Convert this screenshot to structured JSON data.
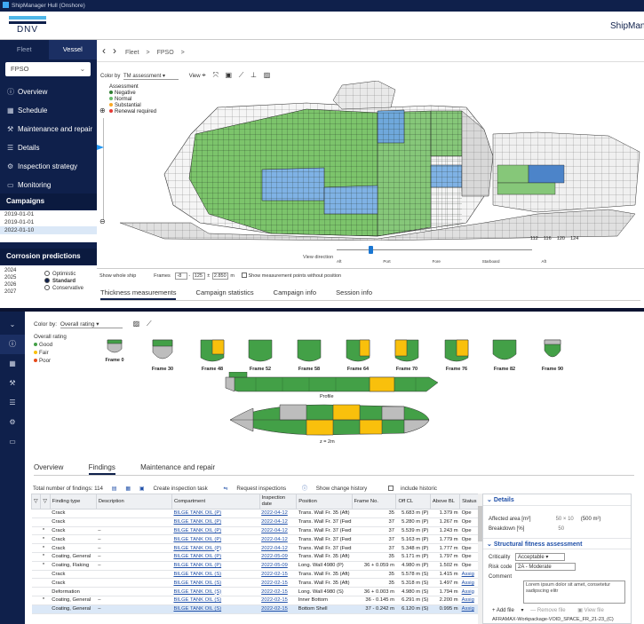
{
  "titlebar": {
    "title": "ShipManager Hull (Onshore)"
  },
  "header": {
    "logo": "DNV",
    "app_title": "ShipMan"
  },
  "sidebar": {
    "tabs": [
      "Fleet",
      "Vessel"
    ],
    "vessel_select": "FPSO",
    "menu": [
      {
        "label": "Overview",
        "icon": "info-icon"
      },
      {
        "label": "Schedule",
        "icon": "calendar-icon"
      },
      {
        "label": "Maintenance and repair",
        "icon": "wrench-icon"
      },
      {
        "label": "Details",
        "icon": "list-icon"
      },
      {
        "label": "Inspection strategy",
        "icon": "gear-icon"
      },
      {
        "label": "Monitoring",
        "icon": "monitor-icon"
      }
    ],
    "campaigns_title": "Campaigns",
    "campaigns": [
      "2019-01-01",
      "2019-01-01",
      "2022-01-10"
    ],
    "corrosion_title": "Corrosion predictions",
    "years": [
      "2024",
      "2025",
      "2026",
      "2027"
    ],
    "scenarios": [
      "Optimistic",
      "Standard",
      "Conservative"
    ]
  },
  "top": {
    "breadcrumb": [
      "Fleet",
      ">",
      "FPSO",
      ">"
    ],
    "color_by_label": "Color by",
    "color_by_value": "TM assessment",
    "view_label": "View",
    "legend_title": "Assessment",
    "legend": [
      {
        "label": "Negative",
        "color": "#2e7d32"
      },
      {
        "label": "Normal",
        "color": "#2e7d32"
      },
      {
        "label": "Substantial",
        "color": "#f9a825"
      },
      {
        "label": "Renewal required",
        "color": "#e53935"
      }
    ],
    "frame_labels": [
      "112",
      "116",
      "120",
      "124"
    ],
    "view_direction_label": "View direction",
    "directions": [
      "Aft",
      "Port",
      "Fore",
      "Starboard",
      "Aft"
    ],
    "show_whole_ship": "Show whole ship",
    "frames_label": "Frames",
    "frame_from": "-8",
    "frame_to": "125",
    "pm": "±",
    "depth": "2.850",
    "unit_m": "m",
    "show_points": "Show measurement points without position",
    "tabs": [
      "Thickness measurements",
      "Campaign statistics",
      "Campaign info",
      "Session info"
    ]
  },
  "bottom": {
    "color_by_label": "Color by:",
    "color_by_value": "Overall rating",
    "legend_title": "Overall rating",
    "legend": [
      {
        "label": "Good",
        "color": "#43a047"
      },
      {
        "label": "Fair",
        "color": "#f9c00c"
      },
      {
        "label": "Poor",
        "color": "#e64a19"
      }
    ],
    "frames": [
      "Frame 0",
      "Frame 30",
      "Frame 48",
      "Frame 52",
      "Frame 58",
      "Frame 64",
      "Frame 70",
      "Frame 76",
      "Frame 82",
      "Frame 90"
    ],
    "profile_label": "Profile",
    "plan_label": "z = 2m",
    "tabs": [
      "Overview",
      "Findings",
      "Maintenance and repair"
    ],
    "total_findings": "Total number of findings: 114",
    "create_task": "Create inspection task",
    "request_inspections": "Request inspections",
    "show_history": "Show change history",
    "include_historic": "include historic",
    "table_headers": [
      "Finding type",
      "Description",
      "Compartment",
      "Inspection date",
      "Position",
      "Frame No.",
      "Off CL",
      "Above BL",
      "Status"
    ],
    "rows": [
      {
        "star": "",
        "type": "Crack",
        "desc": "",
        "comp": "BILGE TANK OIL (P)",
        "date": "2022-04-12",
        "pos": "Trans. Wall Fr. 35 (Aft)",
        "frame": "35",
        "off": "5.683 m (P)",
        "above": "1.379 m",
        "status": "Ope"
      },
      {
        "star": "",
        "type": "Crack",
        "desc": "",
        "comp": "BILGE TANK OIL (P)",
        "date": "2022-04-12",
        "pos": "Trans. Wall Fr. 37 (Fwd.)",
        "frame": "37",
        "off": "5.280 m (P)",
        "above": "1.267 m",
        "status": "Ope"
      },
      {
        "star": "*",
        "type": "Crack",
        "desc": "–",
        "comp": "BILGE TANK OIL (P)",
        "date": "2022-04-12",
        "pos": "Trans. Wall Fr. 37 (Fwd.)",
        "frame": "37",
        "off": "5.539 m (P)",
        "above": "1.243 m",
        "status": "Ope"
      },
      {
        "star": "*",
        "type": "Crack",
        "desc": "–",
        "comp": "BILGE TANK OIL (P)",
        "date": "2022-04-12",
        "pos": "Trans. Wall Fr. 37 (Fwd.)",
        "frame": "37",
        "off": "5.163 m (P)",
        "above": "1.779 m",
        "status": "Ope"
      },
      {
        "star": "*",
        "type": "Crack",
        "desc": "–",
        "comp": "BILGE TANK OIL (P)",
        "date": "2022-04-12",
        "pos": "Trans. Wall Fr. 37 (Fwd.)",
        "frame": "37",
        "off": "5.348 m (P)",
        "above": "1.777 m",
        "status": "Ope"
      },
      {
        "star": "*",
        "type": "Coating, General",
        "desc": "–",
        "comp": "BILGE TANK OIL (P)",
        "date": "2022-05-09",
        "pos": "Trans. Wall Fr. 35 (Aft)",
        "frame": "35",
        "off": "5.171 m (P)",
        "above": "1.797 m",
        "status": "Ope"
      },
      {
        "star": "*",
        "type": "Coating, Flaking",
        "desc": "–",
        "comp": "BILGE TANK OIL (P)",
        "date": "2022-05-09",
        "pos": "Long. Wall 4980 (P)",
        "frame": "36 + 0.059 m",
        "off": "4.980 m (P)",
        "above": "1.502 m",
        "status": "Ope"
      },
      {
        "star": "",
        "type": "Crack",
        "desc": "",
        "comp": "BILGE TANK OIL (S)",
        "date": "2022-02-15",
        "pos": "Trans. Wall Fr. 35 (Aft)",
        "frame": "35",
        "off": "5.578 m (S)",
        "above": "1.415 m",
        "status": "Assig"
      },
      {
        "star": "",
        "type": "Crack",
        "desc": "",
        "comp": "BILGE TANK OIL (S)",
        "date": "2022-02-15",
        "pos": "Trans. Wall Fr. 35 (Aft)",
        "frame": "35",
        "off": "5.318 m (S)",
        "above": "1.497 m",
        "status": "Assig"
      },
      {
        "star": "",
        "type": "Deformation",
        "desc": "",
        "comp": "BILGE TANK OIL (S)",
        "date": "2022-02-15",
        "pos": "Long. Wall 4980 (S)",
        "frame": "36 + 0.003 m",
        "off": "4.980 m (S)",
        "above": "1.794 m",
        "status": "Assig"
      },
      {
        "star": "*",
        "type": "Coating, General",
        "desc": "–",
        "comp": "BILGE TANK OIL (S)",
        "date": "2022-02-15",
        "pos": "Inner Bottom",
        "frame": "36 - 0.145 m",
        "off": "6.291 m (S)",
        "above": "2.200 m",
        "status": "Assig"
      },
      {
        "star": "",
        "type": "Coating, General",
        "desc": "–",
        "comp": "BILGE TANK OIL (S)",
        "date": "2022-02-15",
        "pos": "Bottom Shell",
        "frame": "37 - 0.242 m",
        "off": "6.120 m (S)",
        "above": "0.995 m",
        "status": "Assig"
      }
    ],
    "details_title": "Details",
    "affected_area_label": "Affected area [m²]",
    "affected_area_value": "50 × 10",
    "affected_area_total": "(500 m²)",
    "breakdown_label": "Breakdown [%]",
    "breakdown_value": "50",
    "sfa_title": "Structural fitness assessment",
    "criticality_label": "Criticality",
    "criticality_value": "Acceptable",
    "risk_label": "Risk code",
    "risk_value": "2A - Moderate",
    "comment_label": "Comment",
    "comment_value": "Lorem ipsum dolor sit amet, consetetur sadipscing elitr",
    "add_file": "Add file",
    "remove_file": "Remove file",
    "view_file": "View file",
    "workpackage": "AFRAMAX-Workpackage-VOID_SPACE_FR_21-23_(C)"
  }
}
